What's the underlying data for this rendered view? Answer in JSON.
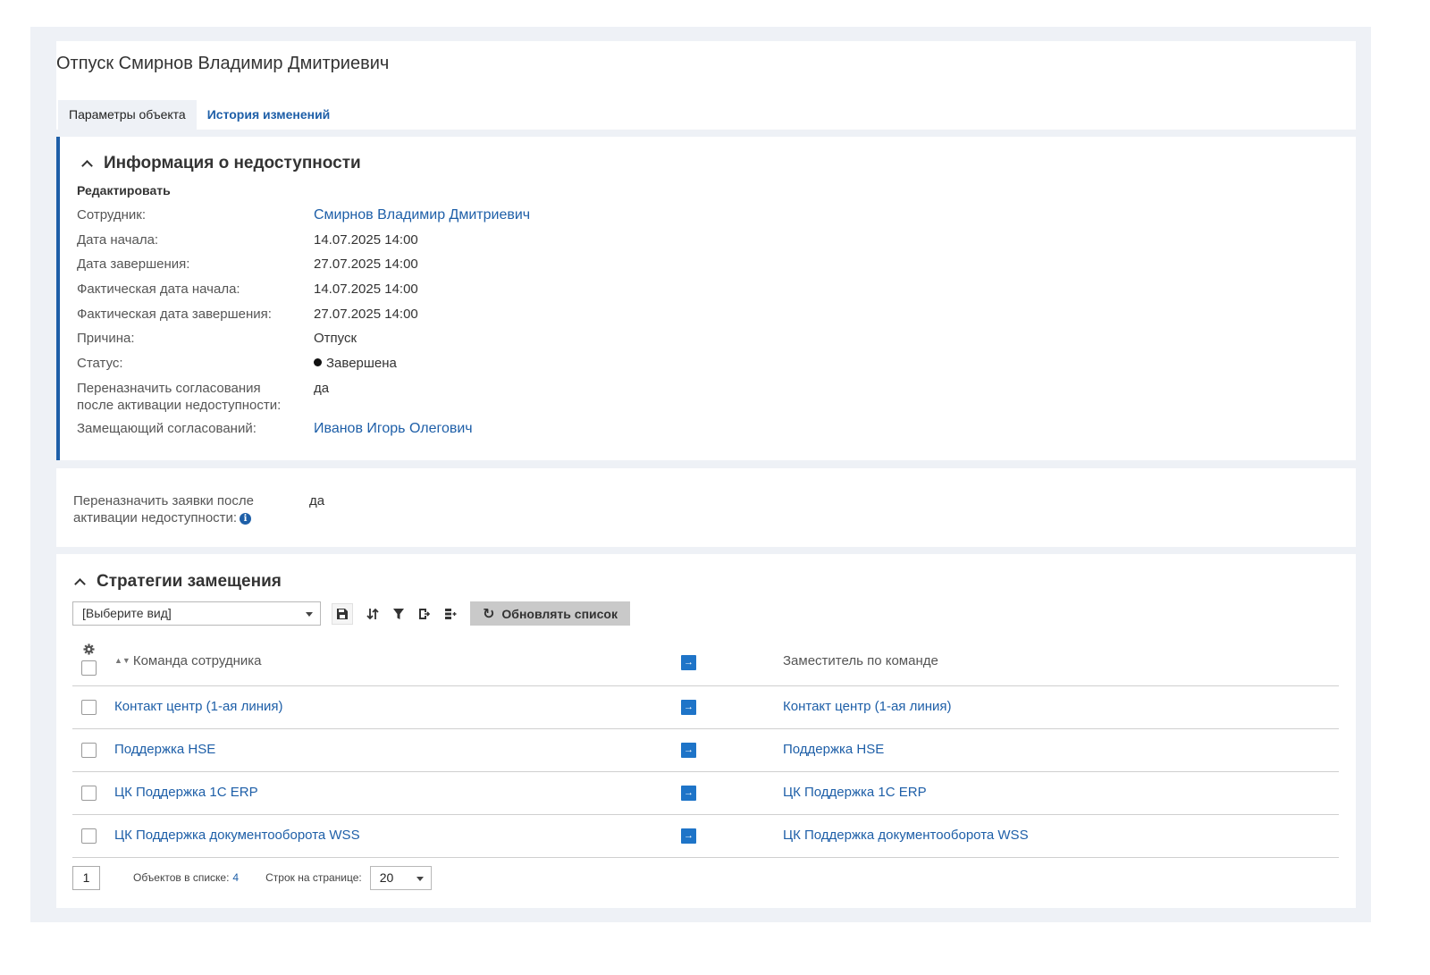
{
  "page": {
    "title": "Отпуск Смирнов Владимир Дмитриевич",
    "tabs": [
      {
        "label": "Параметры объекта",
        "active": true
      },
      {
        "label": "История изменений",
        "active": false
      }
    ]
  },
  "info_section": {
    "title": "Информация о недоступности",
    "edit_label": "Редактировать",
    "fields": {
      "employee": {
        "label": "Сотрудник:",
        "value": "Смирнов Владимир Дмитриевич"
      },
      "start_date": {
        "label": "Дата начала:",
        "value": "14.07.2025 14:00"
      },
      "end_date": {
        "label": "Дата завершения:",
        "value": "27.07.2025 14:00"
      },
      "actual_start": {
        "label": "Фактическая дата начала:",
        "value": "14.07.2025 14:00"
      },
      "actual_end": {
        "label": "Фактическая дата завершения:",
        "value": "27.07.2025 14:00"
      },
      "reason": {
        "label": "Причина:",
        "value": "Отпуск"
      },
      "status": {
        "label": "Статус:",
        "value": "Завершена"
      },
      "reassign_approvals": {
        "label_line1": "Переназначить согласования",
        "label_line2": "после активации недоступности:",
        "value": "да"
      },
      "approval_substitute": {
        "label": "Замещающий согласований:",
        "value": "Иванов Игорь Олегович"
      }
    }
  },
  "reassign_requests": {
    "label_line1": "Переназначить заявки после",
    "label_line2": "активации недоступности:",
    "value": "да"
  },
  "strategies": {
    "title": "Стратегии замещения",
    "view_select_value": "[Выберите вид]",
    "refresh_label": "Обновлять список",
    "columns": {
      "team": "Команда сотрудника",
      "deputy": "Заместитель по команде"
    },
    "rows": [
      {
        "team": "Контакт центр (1-ая линия)",
        "deputy": "Контакт центр (1-ая линия)"
      },
      {
        "team": "Поддержка HSE",
        "deputy": "Поддержка HSE"
      },
      {
        "team": "ЦК Поддержка 1С ERP",
        "deputy": "ЦК Поддержка 1С ERP"
      },
      {
        "team": "ЦК Поддержка документооборота WSS",
        "deputy": "ЦК Поддержка документооборота WSS"
      }
    ],
    "pager": {
      "page": "1",
      "objects_label": "Объектов в списке:",
      "objects_count": "4",
      "rows_label": "Строк на странице:",
      "rows_value": "20"
    }
  },
  "colors": {
    "accent": "#1e5fa8",
    "background": "#eef1f6"
  }
}
